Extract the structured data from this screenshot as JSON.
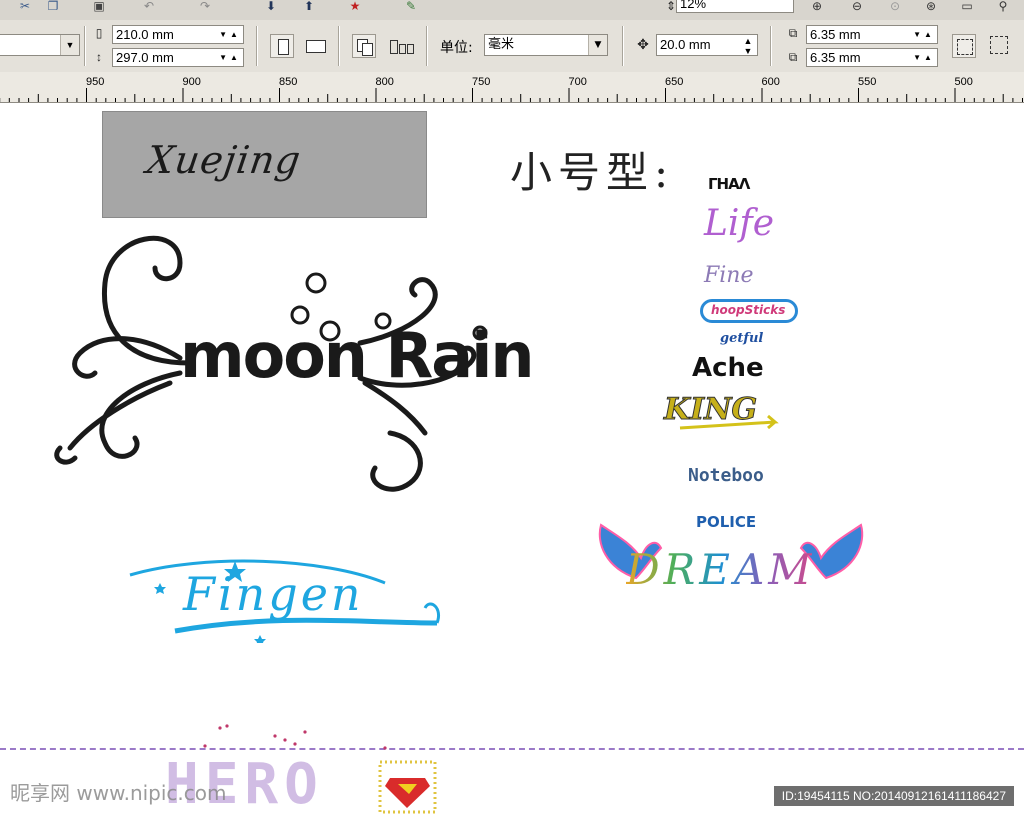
{
  "toolbar": {
    "zoom_value": "12%",
    "page_width": "210.0 mm",
    "page_height": "297.0 mm",
    "units_label": "单位:",
    "units_value": "毫米",
    "nudge_value": "20.0 mm",
    "dup_x": "6.35 mm",
    "dup_y": "6.35 mm"
  },
  "ruler": {
    "ticks": [
      "950",
      "900",
      "850",
      "800",
      "750",
      "700",
      "650",
      "600",
      "550",
      "500"
    ]
  },
  "canvas": {
    "xuejing_text": "Xuejing",
    "moon_rain_text": "moon Rain",
    "finger_text": "Fingen",
    "heading": "小号型:",
    "small_logos": [
      "ΓΗΑΛ",
      "Life",
      "Fine",
      "hoopSticks",
      "getful",
      "Ache",
      "KING",
      "Noteboo",
      "POLICE",
      "DREAM"
    ],
    "hero_text": "HERO"
  },
  "watermark": {
    "left": "昵享网 www.nipic.com",
    "right": "ID:19454115 NO:20140912161411186427"
  },
  "colors": {
    "finger_blue": "#1ea6e0",
    "canvas_bg": "#ffffff",
    "dream_wing": "#3b83d6"
  }
}
